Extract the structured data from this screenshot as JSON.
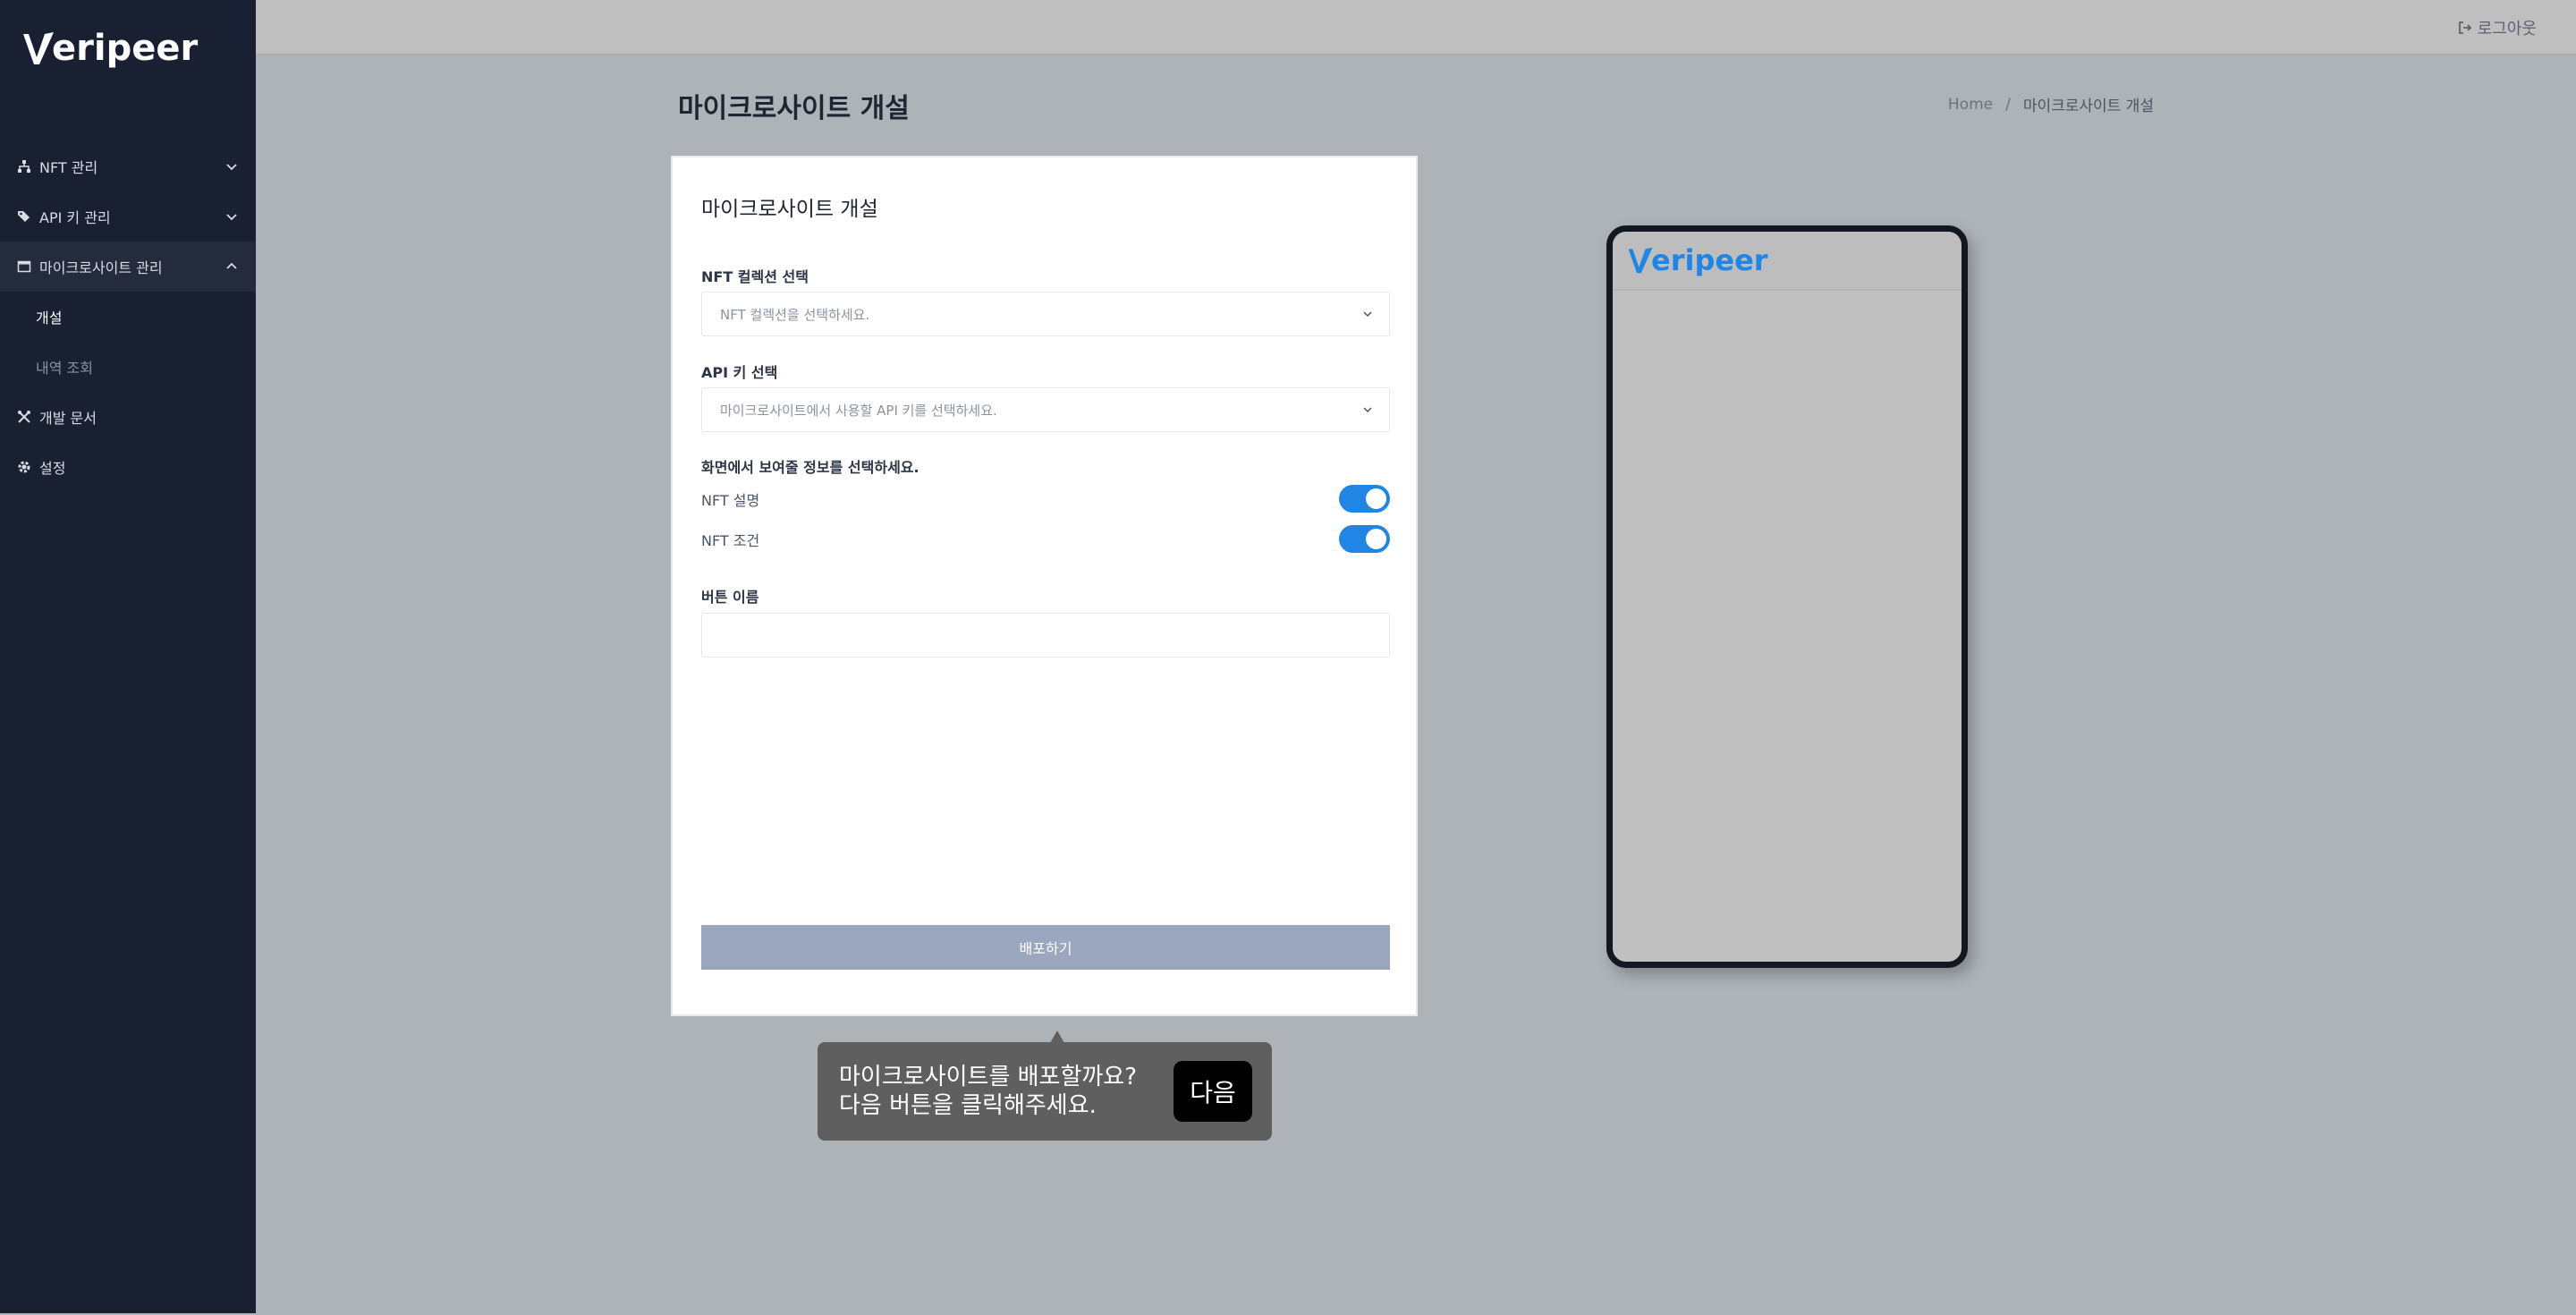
{
  "brand": {
    "logo_text": "eripeer",
    "accent": "#1f86e6"
  },
  "sidebar": {
    "items": [
      {
        "label": "NFT 관리",
        "icon": "sitemap-icon",
        "expanded": false
      },
      {
        "label": "API 키 관리",
        "icon": "tags-icon",
        "expanded": false
      },
      {
        "label": "마이크로사이트 관리",
        "icon": "window-icon",
        "expanded": true,
        "children": [
          {
            "label": "개설",
            "active": true
          },
          {
            "label": "내역 조회",
            "active": false
          }
        ]
      },
      {
        "label": "개발 문서",
        "icon": "tools-icon"
      },
      {
        "label": "설정",
        "icon": "gear-icon"
      }
    ]
  },
  "topbar": {
    "logout_label": "로그아웃"
  },
  "page": {
    "title": "마이크로사이트 개설",
    "breadcrumb": {
      "home": "Home",
      "separator": "/",
      "current": "마이크로사이트 개설"
    }
  },
  "form": {
    "card_title": "마이크로사이트 개설",
    "nft_label": "NFT 컬렉션 선택",
    "nft_placeholder": "NFT 컬렉션을 선택하세요.",
    "api_label": "API 키 선택",
    "api_placeholder": "마이크로사이트에서 사용할 API 키를 선택하세요.",
    "display_label": "화면에서 보여줄 정보를 선택하세요.",
    "toggles": [
      {
        "label": "NFT 설명",
        "on": true
      },
      {
        "label": "NFT 조건",
        "on": true
      }
    ],
    "button_name_label": "버튼 이름",
    "button_name_value": "",
    "deploy_label": "배포하기"
  },
  "preview": {
    "logo_text": "eripeer"
  },
  "tooltip": {
    "line1": "마이크로사이트를 배포할까요?",
    "line2": "다음 버튼을 클릭해주세요.",
    "next_label": "다음"
  }
}
